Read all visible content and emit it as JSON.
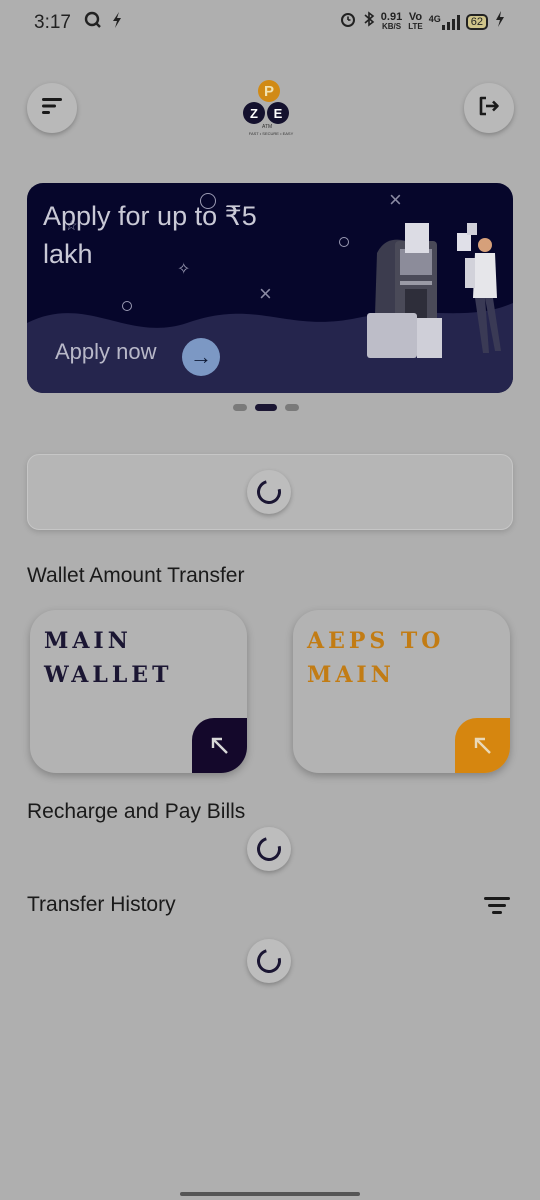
{
  "status_bar": {
    "time": "3:17",
    "left_icons": [
      "search-status-icon",
      "flash-icon"
    ],
    "net_speed_value": "0.91",
    "net_speed_unit": "KB/S",
    "volte_top": "Vo",
    "volte_bottom": "LTE",
    "network": "4G",
    "battery": "62"
  },
  "header": {
    "logo_letter_top": "P",
    "logo_letters": [
      "Z",
      "E"
    ],
    "logo_atm": "ATM",
    "logo_tagline": "FAST • SECURE • EASY"
  },
  "banner": {
    "title": "Apply for up to ₹5 lakh",
    "cta": "Apply now",
    "carousel_dots": 3,
    "active_dot": 1
  },
  "sections": {
    "wallet_transfer": "Wallet Amount Transfer",
    "recharge": "Recharge and Pay Bills",
    "history": "Transfer History"
  },
  "wallet_cards": {
    "main": "MAIN WALLET",
    "aeps": "AEPS TO MAIN"
  },
  "colors": {
    "accent_dark": "#1b1633",
    "accent_orange": "#d6860f",
    "banner_bg": "#06062b"
  }
}
